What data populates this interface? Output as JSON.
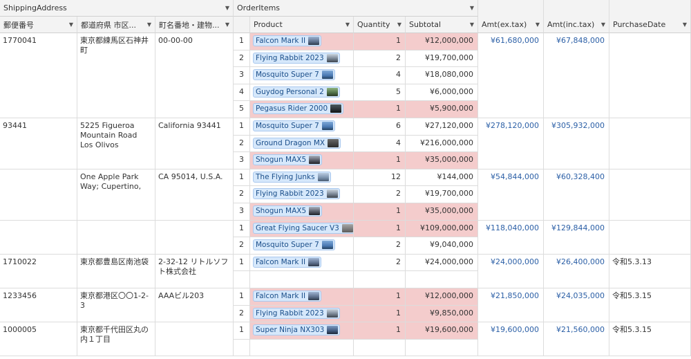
{
  "headers": {
    "group_shipping": "ShippingAddress",
    "group_orderitems": "OrderItems",
    "postal": "郵便番号",
    "pref": "都道府県 市区...",
    "street": "町名番地・建物...",
    "product": "Product",
    "quantity": "Quantity",
    "subtotal": "Subtotal",
    "amt_ex": "Amt(ex.tax)",
    "amt_inc": "Amt(inc.tax)",
    "purchase_date": "PurchaseDate"
  },
  "icons": {
    "dropdown": "caret-down-icon"
  },
  "colors": {
    "highlight_pink": "#f4cccc",
    "amount_blue": "#2b5fa6",
    "pill_blue": "#d6e8fb"
  },
  "records": [
    {
      "postal": "1770041",
      "pref": "東京都練馬区石神井町",
      "street": "00-00-00",
      "amt_ex": "¥61,680,000",
      "amt_inc": "¥67,848,000",
      "date": "",
      "items": [
        {
          "idx": "1",
          "product": "Falcon Mark II",
          "qty": "1",
          "subtotal": "¥12,000,000"
        },
        {
          "idx": "2",
          "product": "Flying Rabbit 2023",
          "qty": "2",
          "subtotal": "¥19,700,000"
        },
        {
          "idx": "3",
          "product": "Mosquito Super 7",
          "qty": "4",
          "subtotal": "¥18,080,000"
        },
        {
          "idx": "4",
          "product": "Guydog Personal 2",
          "qty": "5",
          "subtotal": "¥6,000,000"
        },
        {
          "idx": "5",
          "product": "Pegasus Rider 2000",
          "qty": "1",
          "subtotal": "¥5,900,000"
        }
      ]
    },
    {
      "postal": "93441",
      "pref": "5225 Figueroa Mountain Road Los Olivos",
      "street": "California 93441",
      "amt_ex": "¥278,120,000",
      "amt_inc": "¥305,932,000",
      "date": "",
      "items": [
        {
          "idx": "1",
          "product": "Mosquito Super 7",
          "qty": "6",
          "subtotal": "¥27,120,000"
        },
        {
          "idx": "2",
          "product": "Ground Dragon MX",
          "qty": "4",
          "subtotal": "¥216,000,000"
        },
        {
          "idx": "3",
          "product": "Shogun MAX5",
          "qty": "1",
          "subtotal": "¥35,000,000"
        }
      ]
    },
    {
      "postal": "",
      "pref": "One Apple Park Way; Cupertino,",
      "street": "CA 95014, U.S.A.",
      "amt_ex": "¥54,844,000",
      "amt_inc": "¥60,328,400",
      "date": "",
      "items": [
        {
          "idx": "1",
          "product": "The Flying Junks",
          "qty": "12",
          "subtotal": "¥144,000"
        },
        {
          "idx": "2",
          "product": "Flying Rabbit 2023",
          "qty": "2",
          "subtotal": "¥19,700,000"
        },
        {
          "idx": "3",
          "product": "Shogun MAX5",
          "qty": "1",
          "subtotal": "¥35,000,000"
        }
      ]
    },
    {
      "postal": "",
      "pref": "",
      "street": "",
      "amt_ex": "¥118,040,000",
      "amt_inc": "¥129,844,000",
      "date": "",
      "items": [
        {
          "idx": "1",
          "product": "Great Flying Saucer V3",
          "qty": "1",
          "subtotal": "¥109,000,000"
        },
        {
          "idx": "2",
          "product": "Mosquito Super 7",
          "qty": "2",
          "subtotal": "¥9,040,000"
        }
      ]
    },
    {
      "postal": "1710022",
      "pref": "東京都豊島区南池袋",
      "street": "2-32-12 リトルソフト株式会社",
      "amt_ex": "¥24,000,000",
      "amt_inc": "¥26,400,000",
      "date": "令和5.3.13",
      "items": [
        {
          "idx": "1",
          "product": "Falcon Mark II",
          "qty": "2",
          "subtotal": "¥24,000,000"
        }
      ]
    },
    {
      "postal": "1233456",
      "pref": "東京都港区〇〇1-2-3",
      "street": "AAAビル203",
      "amt_ex": "¥21,850,000",
      "amt_inc": "¥24,035,000",
      "date": "令和5.3.15",
      "items": [
        {
          "idx": "1",
          "product": "Falcon Mark II",
          "qty": "1",
          "subtotal": "¥12,000,000"
        },
        {
          "idx": "2",
          "product": "Flying Rabbit 2023",
          "qty": "1",
          "subtotal": "¥9,850,000"
        }
      ]
    },
    {
      "postal": "1000005",
      "pref": "東京都千代田区丸の内１丁目",
      "street": "",
      "amt_ex": "¥19,600,000",
      "amt_inc": "¥21,560,000",
      "date": "令和5.3.15",
      "items": [
        {
          "idx": "1",
          "product": "Super Ninja NX303",
          "qty": "1",
          "subtotal": "¥19,600,000"
        }
      ]
    }
  ]
}
